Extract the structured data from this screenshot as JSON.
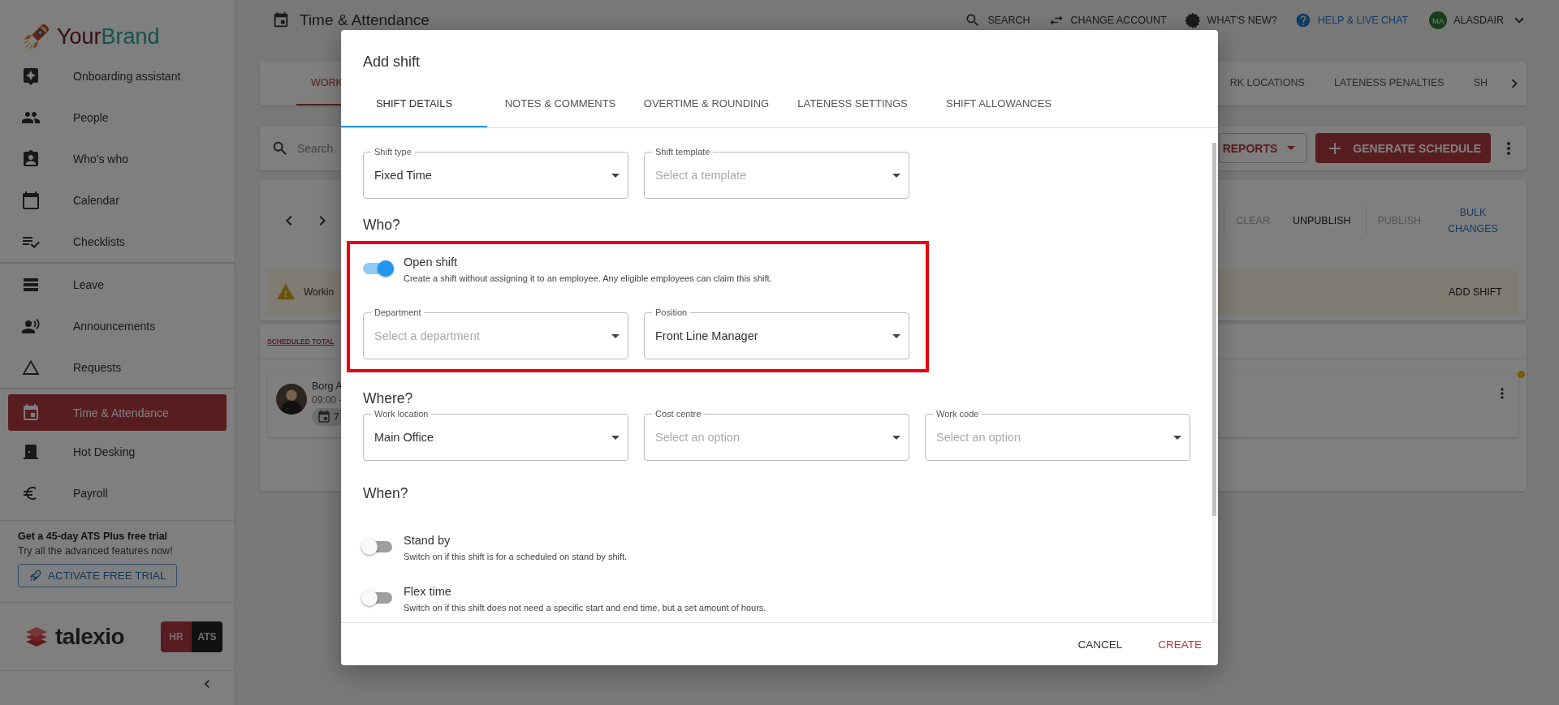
{
  "sidebar": {
    "brand": {
      "prefix": "Your",
      "suffix": "Brand"
    },
    "sections": [
      {
        "items": [
          {
            "label": "Onboarding assistant",
            "selected": false
          },
          {
            "label": "People",
            "selected": false
          },
          {
            "label": "Who's who",
            "selected": false
          },
          {
            "label": "Calendar",
            "selected": false
          },
          {
            "label": "Checklists",
            "selected": false
          }
        ]
      },
      {
        "items": [
          {
            "label": "Leave",
            "selected": false
          },
          {
            "label": "Announcements",
            "selected": false
          },
          {
            "label": "Requests",
            "selected": false
          }
        ]
      },
      {
        "items": [
          {
            "label": "Time & Attendance",
            "selected": true
          },
          {
            "label": "Hot Desking",
            "selected": false
          },
          {
            "label": "Payroll",
            "selected": false
          }
        ]
      }
    ],
    "trial": {
      "title": "Get a 45-day ATS Plus free trial",
      "text": "Try all the advanced features now!",
      "button": "ACTIVATE FREE TRIAL"
    },
    "product": {
      "name": "talexio",
      "modules": [
        {
          "label": "HR",
          "selected": true
        },
        {
          "label": "ATS",
          "selected": false
        }
      ]
    }
  },
  "header": {
    "title": "Time & Attendance",
    "actions": [
      {
        "label": "SEARCH",
        "kind": "plain"
      },
      {
        "label": "CHANGE ACCOUNT",
        "kind": "plain"
      },
      {
        "label": "WHAT'S NEW?",
        "kind": "plain"
      },
      {
        "label": "HELP & LIVE CHAT",
        "kind": "link"
      }
    ],
    "user": {
      "initials": "MA",
      "name": "ALASDAIR"
    }
  },
  "nav_tabs": [
    {
      "label": "WORK",
      "selected": true
    },
    {
      "label": "RK LOCATIONS",
      "selected": false
    },
    {
      "label": "LATENESS PENALTIES",
      "selected": false
    },
    {
      "label": "SH",
      "selected": false
    }
  ],
  "search": {
    "placeholder": "Search"
  },
  "actions": {
    "reports": "REPORTS",
    "generate": "GENERATE SCHEDULE"
  },
  "schedule_toolbar": [
    {
      "label": "CLEAR",
      "disabled": true,
      "kind": "text"
    },
    {
      "label": "UNPUBLISH",
      "disabled": false,
      "kind": "text"
    },
    {
      "label": "PUBLISH",
      "disabled": true,
      "kind": "text"
    },
    {
      "label": "BULK CHANGES",
      "disabled": false,
      "kind": "link"
    }
  ],
  "banner": {
    "text": "Workin",
    "action": "ADD SHIFT"
  },
  "schedule": {
    "total_label": "SCHEDULED TOTAL",
    "shift": {
      "name": "Borg A",
      "time": "09:00 -",
      "chip": "7"
    }
  },
  "dialog": {
    "title": "Add shift",
    "tabs": [
      {
        "label": "SHIFT DETAILS",
        "selected": true
      },
      {
        "label": "NOTES & COMMENTS",
        "selected": false
      },
      {
        "label": "OVERTIME & ROUNDING",
        "selected": false
      },
      {
        "label": "LATENESS SETTINGS",
        "selected": false
      },
      {
        "label": "SHIFT ALLOWANCES",
        "selected": false
      }
    ],
    "shift_fields": [
      {
        "label": "Shift type",
        "value": "Fixed Time"
      },
      {
        "label": "Shift template",
        "placeholder": "Select a template"
      }
    ],
    "who": {
      "heading": "Who?",
      "highlighted": true,
      "open_shift": {
        "label": "Open shift",
        "description": "Create a shift without assigning it to an employee. Any eligible employees can claim this shift.",
        "on": true
      },
      "fields": [
        {
          "label": "Department",
          "placeholder": "Select a department"
        },
        {
          "label": "Position",
          "value": "Front Line Manager"
        }
      ]
    },
    "where": {
      "heading": "Where?",
      "fields": [
        {
          "label": "Work location",
          "value": "Main Office"
        },
        {
          "label": "Cost centre",
          "placeholder": "Select an option"
        },
        {
          "label": "Work code",
          "placeholder": "Select an option"
        }
      ]
    },
    "when": {
      "heading": "When?",
      "toggles": [
        {
          "label": "Stand by",
          "description": "Switch on if this shift is for a scheduled on stand by shift.",
          "on": false
        },
        {
          "label": "Flex time",
          "description": "Switch on if this shift does not need a specific start and end time, but a set amount of hours.",
          "on": false
        }
      ]
    },
    "buttons": [
      {
        "label": "CANCEL",
        "kind": "secondary"
      },
      {
        "label": "CREATE",
        "kind": "primary"
      }
    ]
  }
}
